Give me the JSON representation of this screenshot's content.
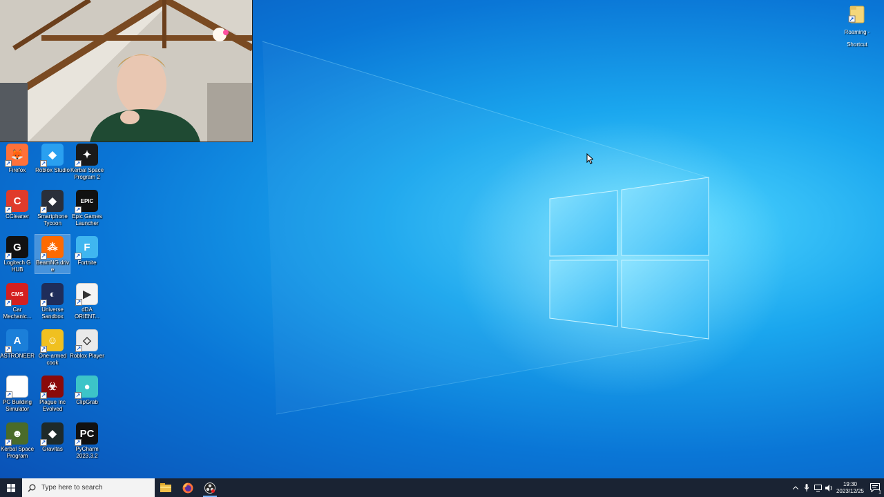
{
  "desktop": {
    "icons": [
      {
        "label": "Firefox",
        "icon": "firefox-icon",
        "color": "#ff7139",
        "glyph": "🦊"
      },
      {
        "label": "Roblox Studio",
        "icon": "roblox-studio-icon",
        "color": "#2aa0f0",
        "glyph": "◆"
      },
      {
        "label": "Kerbal Space Program 2",
        "icon": "ksp2-icon",
        "color": "#1a1a1a",
        "glyph": "✦"
      },
      {
        "label": "CCleaner",
        "icon": "ccleaner-icon",
        "color": "#e03b2a",
        "glyph": "C"
      },
      {
        "label": "Smartphone Tycoon",
        "icon": "smartphone-tycoon-icon",
        "color": "#2a2f3a",
        "glyph": "◆"
      },
      {
        "label": "Epic Games Launcher",
        "icon": "epic-games-icon",
        "color": "#111111",
        "glyph": "EPIC"
      },
      {
        "label": "Logitech G HUB",
        "icon": "logitech-ghub-icon",
        "color": "#111111",
        "glyph": "G"
      },
      {
        "label": "BeamNG.drive",
        "icon": "beamng-icon",
        "color": "#ff6a00",
        "glyph": "⁂"
      },
      {
        "label": "Fortnite",
        "icon": "fortnite-icon",
        "color": "#3fb6f0",
        "glyph": "F"
      },
      {
        "label": "Car Mechanic...",
        "icon": "car-mechanic-icon",
        "color": "#d42020",
        "glyph": "CMS"
      },
      {
        "label": "Universe Sandbox",
        "icon": "universe-sandbox-icon",
        "color": "#1f2d5a",
        "glyph": "◐"
      },
      {
        "label": "dDA ORIENT...",
        "icon": "media-file-icon",
        "color": "#f4f4f4",
        "glyph": "▶"
      },
      {
        "label": "ASTRONEER",
        "icon": "astroneer-icon",
        "color": "#1b7fd9",
        "glyph": "A"
      },
      {
        "label": "One-armed cook",
        "icon": "one-armed-cook-icon",
        "color": "#f0c020",
        "glyph": "☺"
      },
      {
        "label": "Roblox Player",
        "icon": "roblox-player-icon",
        "color": "#eaeaea",
        "glyph": "◇"
      },
      {
        "label": "PC Building Simulator",
        "icon": "blank-file-icon",
        "color": "#ffffff",
        "glyph": ""
      },
      {
        "label": "Plague Inc Evolved",
        "icon": "plague-inc-icon",
        "color": "#8a0a0a",
        "glyph": "☣"
      },
      {
        "label": "ClipGrab",
        "icon": "clipgrab-icon",
        "color": "#3cc4c8",
        "glyph": "●"
      },
      {
        "label": "Kerbal Space Program",
        "icon": "ksp-icon",
        "color": "#4a6b2a",
        "glyph": "☻"
      },
      {
        "label": "Gravitas",
        "icon": "gravitas-icon",
        "color": "#1e2a2a",
        "glyph": "◆"
      },
      {
        "label": "PyCharm 2023.3.2",
        "icon": "pycharm-icon",
        "color": "#111111",
        "glyph": "PC"
      }
    ],
    "roaming_shortcut": {
      "label": "Roaming - Shortcut",
      "icon": "folder-shortcut-icon"
    }
  },
  "taskbar": {
    "search_placeholder": "Type here to search",
    "pinned": [
      {
        "name": "file-explorer-icon",
        "glyph": "📁",
        "active": false
      },
      {
        "name": "firefox-taskbar-icon",
        "glyph": "🦊",
        "active": false
      },
      {
        "name": "obs-taskbar-icon",
        "glyph": "◉",
        "active": true
      }
    ],
    "clock_time": "19:30",
    "clock_date": "2023/12/25",
    "notification_count": "1"
  },
  "colors": {
    "taskbar_bg": "#1a2333",
    "wallpaper_accent": "#1aa6ee"
  }
}
